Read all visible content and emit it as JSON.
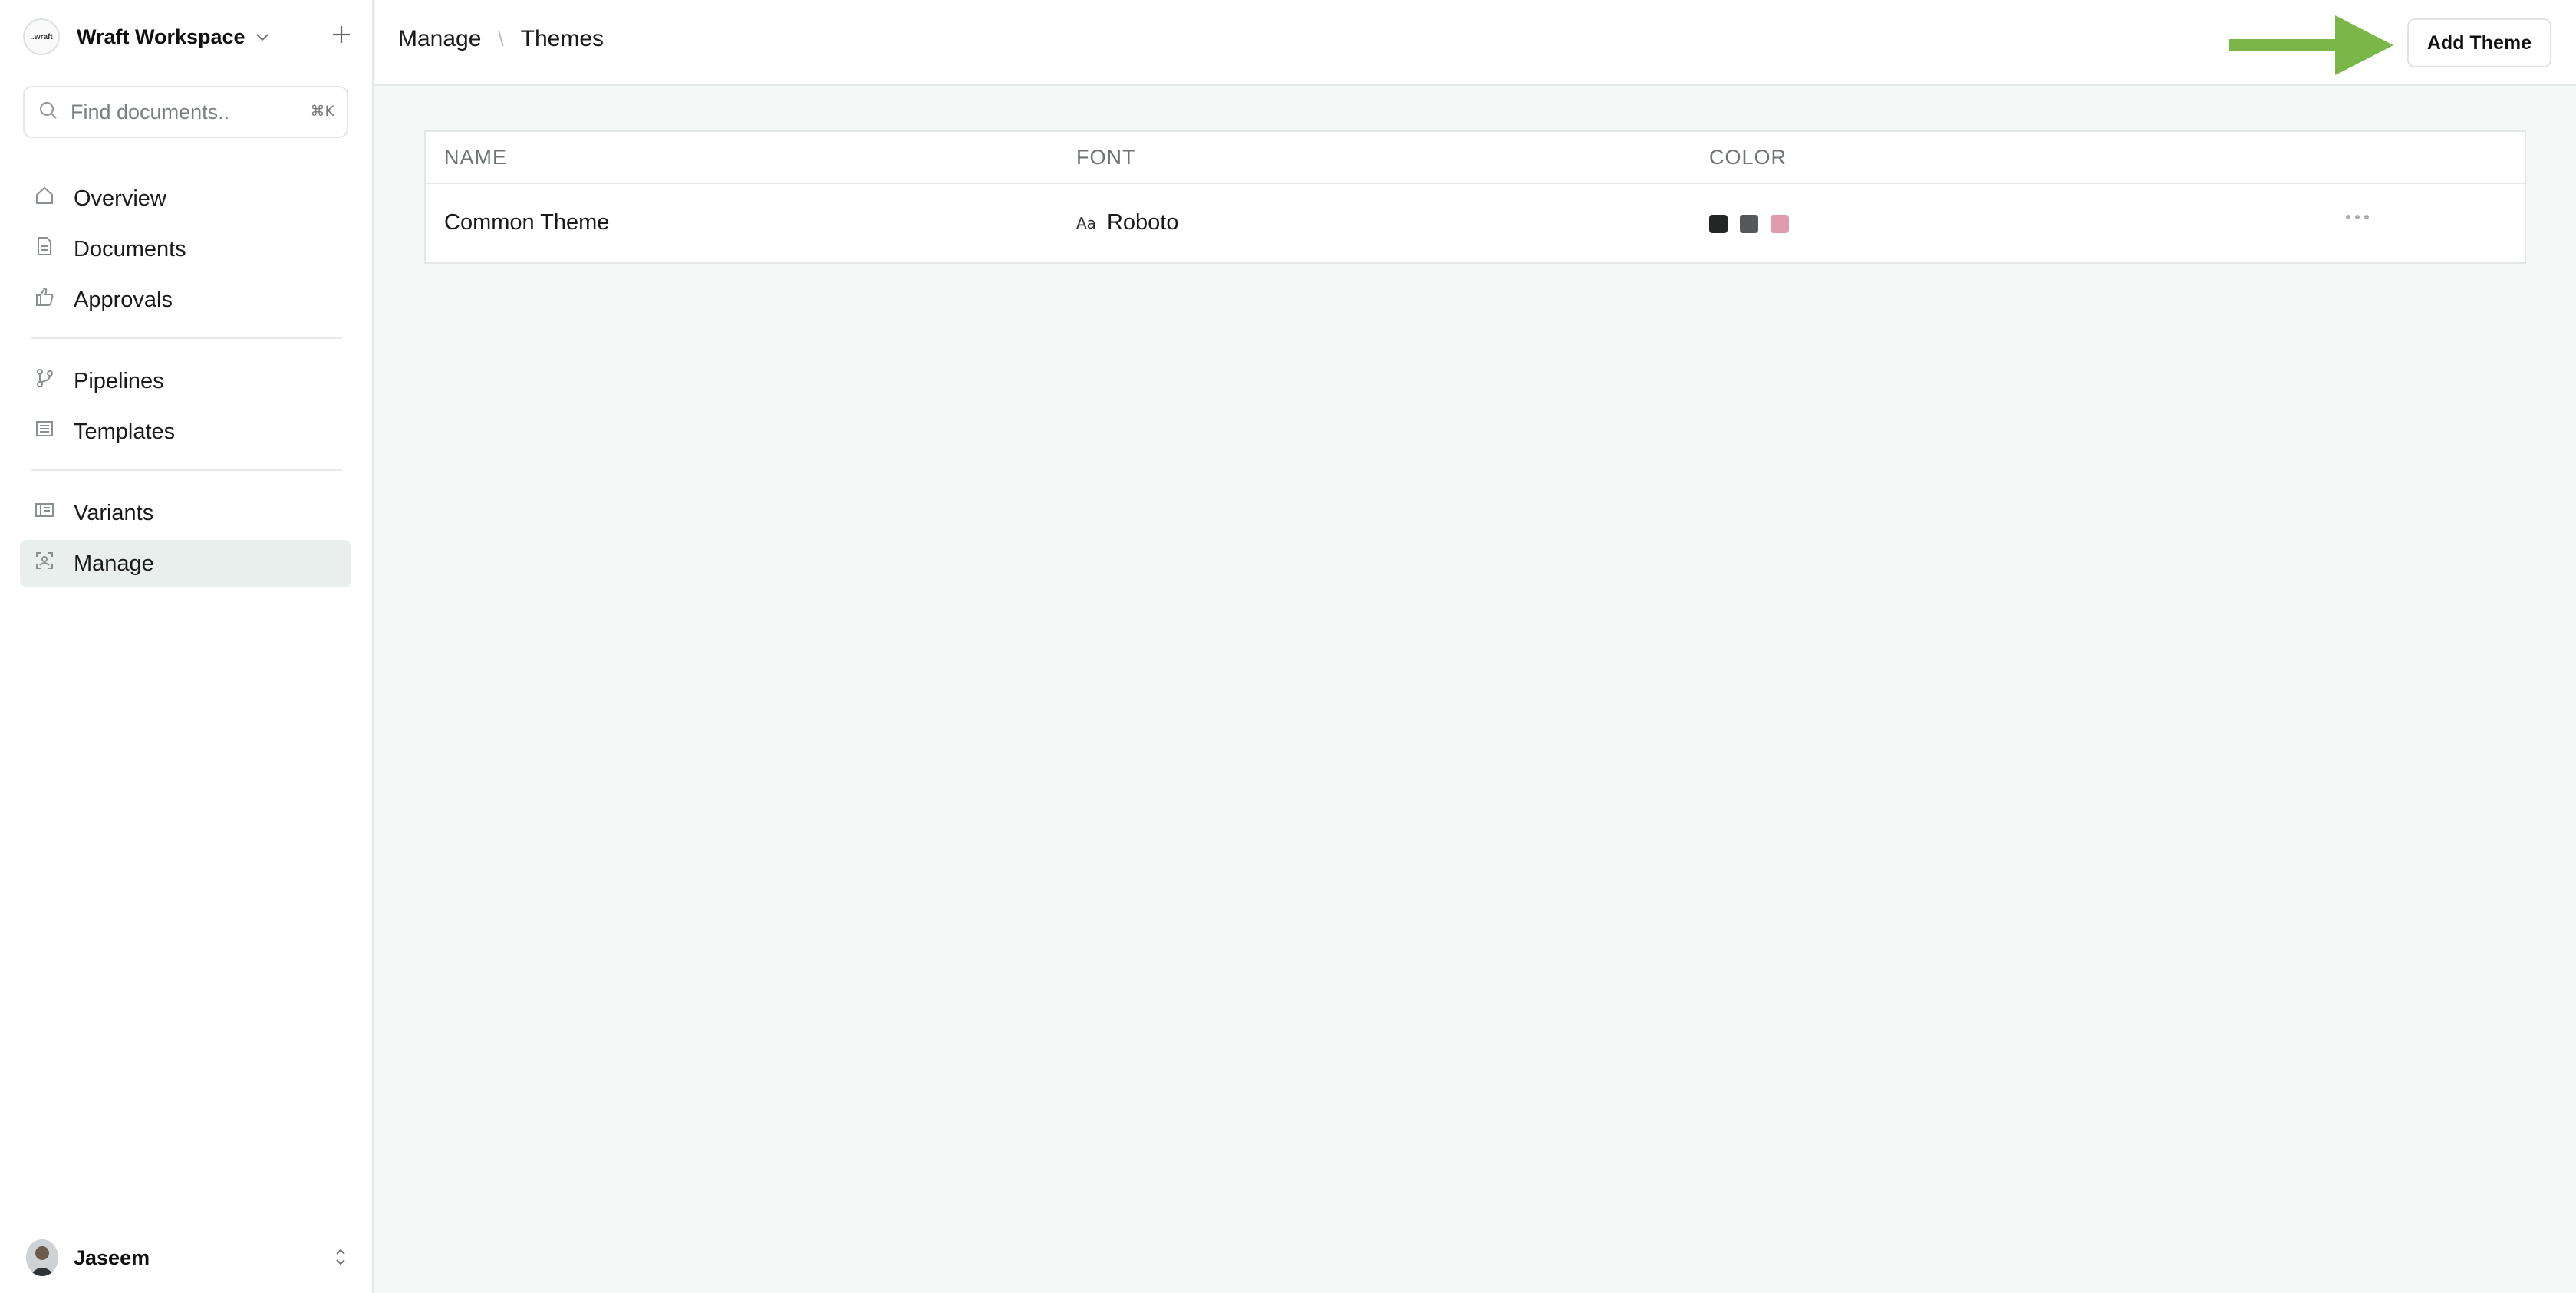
{
  "workspace": {
    "logo_text": "..wraft",
    "name": "Wraft Workspace"
  },
  "search": {
    "placeholder": "Find documents..",
    "shortcut": "⌘K"
  },
  "nav": {
    "overview": "Overview",
    "documents": "Documents",
    "approvals": "Approvals",
    "pipelines": "Pipelines",
    "templates": "Templates",
    "variants": "Variants",
    "manage": "Manage"
  },
  "user": {
    "name": "Jaseem"
  },
  "breadcrumb": {
    "parent": "Manage",
    "separator": "\\",
    "current": "Themes"
  },
  "toolbar": {
    "add_theme_label": "Add Theme"
  },
  "table": {
    "columns": {
      "name": "NAME",
      "font": "FONT",
      "color": "COLOR"
    },
    "rows": [
      {
        "name": "Common Theme",
        "font_glyph": "Aa",
        "font": "Roboto",
        "colors": [
          "#222625",
          "#55595a",
          "#e29aad"
        ]
      }
    ]
  },
  "colors": {
    "accent_arrow": "#7ab648",
    "active_nav_bg": "#e9efed"
  }
}
